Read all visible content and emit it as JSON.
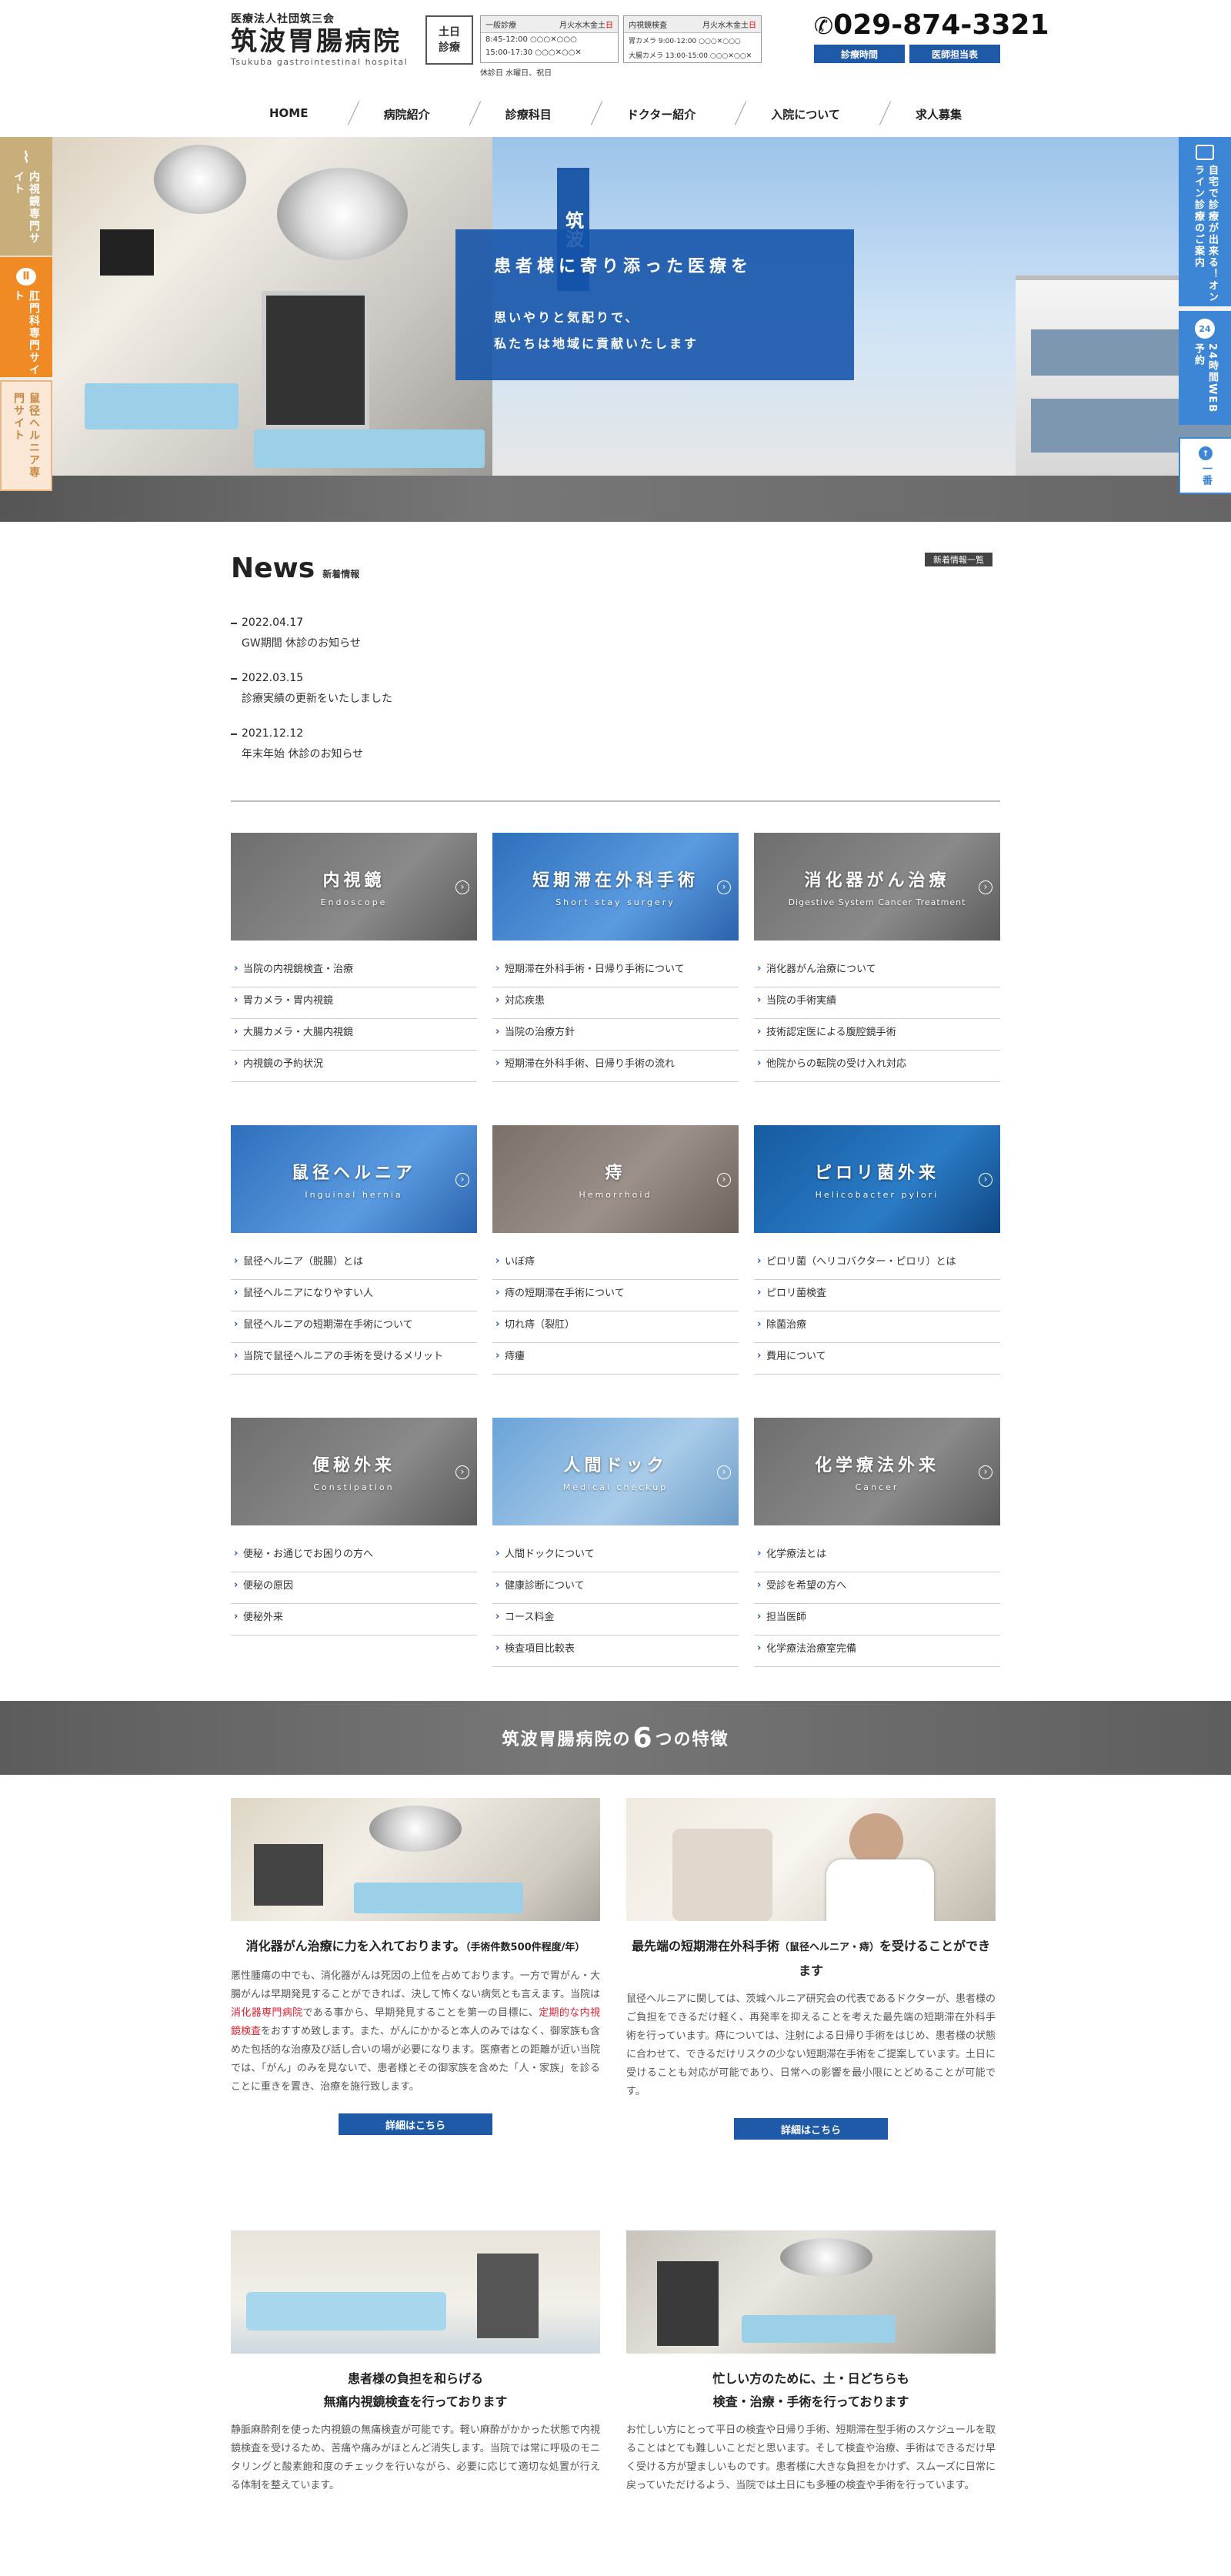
{
  "header": {
    "corp": "医療法人社団筑三会",
    "name": "筑波胃腸病院",
    "en": "Tsukuba gastrointestinal hospital",
    "weekend": "土日診療",
    "sched1": {
      "title": "一般診療",
      "days": "月火水木金土",
      "red": "日",
      "row1": "8:45-12:00 ○○○✕○○○",
      "row2": "15:00-17:30 ○○○✕○○✕"
    },
    "sched2": {
      "title": "内視鏡検査",
      "days": "月火水木金土",
      "red": "日",
      "row1": "胃カメラ 9:00-12:00 ○○○✕○○○",
      "row2": "大腸カメラ 13:00-15:00 ○○○✕○○✕"
    },
    "holiday": "休診日 水曜日、祝日",
    "tel": "029-874-3321",
    "btn_hours": "診療時間",
    "btn_doctor": "医師担当表"
  },
  "nav": [
    "HOME",
    "病院紹介",
    "診療科目",
    "ドクター紹介",
    "入院について",
    "求人募集"
  ],
  "hero": {
    "title": "患者様に寄り添った医療を",
    "line1": "思いやりと気配りで、",
    "line2": "私たちは地域に貢献いたします",
    "sign": "筑波"
  },
  "left_tabs": [
    "内視鏡専門サイト",
    "肛門科専門サイト",
    "鼠径ヘルニア専門サイト"
  ],
  "right_tabs": [
    "自宅で診療が出来る！オンライン診療のご案内",
    "24時間WEB予約",
    "一番"
  ],
  "news": {
    "title": "News",
    "sub": "新着情報",
    "list_button": "新着情報一覧",
    "items": [
      {
        "date": "2022.04.17",
        "text": "GW期間 休診のお知らせ"
      },
      {
        "date": "2022.03.15",
        "text": "診療実績の更新をいたしました"
      },
      {
        "date": "2021.12.12",
        "text": "年末年始 休診のお知らせ"
      }
    ]
  },
  "categories": [
    {
      "jp": "内視鏡",
      "en": "Endoscope",
      "items": [
        "当院の内視鏡検査・治療",
        "胃カメラ・胃内視鏡",
        "大腸カメラ・大腸内視鏡",
        "内視鏡の予約状況"
      ]
    },
    {
      "jp": "短期滞在外科手術",
      "en": "Short stay surgery",
      "items": [
        "短期滞在外科手術・日帰り手術について",
        "対応疾患",
        "当院の治療方針",
        "短期滞在外科手術、日帰り手術の流れ"
      ]
    },
    {
      "jp": "消化器がん治療",
      "en": "Digestive System Cancer Treatment",
      "items": [
        "消化器がん治療について",
        "当院の手術実績",
        "技術認定医による腹腔鏡手術",
        "他院からの転院の受け入れ対応"
      ]
    },
    {
      "jp": "鼠径ヘルニア",
      "en": "Inguinal hernia",
      "items": [
        "鼠径ヘルニア（脱腸）とは",
        "鼠径ヘルニアになりやすい人",
        "鼠径ヘルニアの短期滞在手術について",
        "当院で鼠径ヘルニアの手術を受けるメリット"
      ]
    },
    {
      "jp": "痔",
      "en": "Hemorrhoid",
      "items": [
        "いぼ痔",
        "痔の短期滞在手術について",
        "切れ痔（裂肛）",
        "痔瘻"
      ]
    },
    {
      "jp": "ピロリ菌外来",
      "en": "Helicobacter pylori",
      "items": [
        "ピロリ菌（ヘリコバクター・ピロリ）とは",
        "ピロリ菌検査",
        "除菌治療",
        "費用について"
      ]
    },
    {
      "jp": "便秘外来",
      "en": "Constipation",
      "items": [
        "便秘・お通じでお困りの方へ",
        "便秘の原因",
        "便秘外来"
      ]
    },
    {
      "jp": "人間ドック",
      "en": "Medical checkup",
      "items": [
        "人間ドックについて",
        "健康診断について",
        "コース料金",
        "検査項目比較表"
      ]
    },
    {
      "jp": "化学療法外来",
      "en": "Cancer",
      "items": [
        "化学療法とは",
        "受診を希望の方へ",
        "担当医師",
        "化学療法治療室完備"
      ]
    }
  ],
  "features": {
    "band_pre": "筑波胃腸病院の",
    "band_num": "6",
    "band_post": "つの特徴",
    "more": "詳細はこちら",
    "f1": {
      "title": "消化器がん治療に力を入れております。",
      "small": "（手術件数500件程度/年）",
      "p1": "悪性腫瘍の中でも、消化器がんは死因の上位を占めております。一方で胃がん・大腸がんは早期発見することができれば、決して怖くない病気とも言えます。当院は",
      "hl1": "消化器専門病院",
      "p2": "である事から、早期発見することを第一の目標に、",
      "hl2": "定期的な内視鏡検査",
      "p3": "をおすすめ致します。また、がんにかかると本人のみではなく、御家族も含めた包括的な治療及び話し合いの場が必要になります。医療者との距離が近い当院では、「がん」のみを見ないで、患者様とその御家族を含めた「人・家族」を診ることに重きを置き、治療を施行致します。"
    },
    "f2": {
      "title": "最先端の短期滞在外科手術",
      "small": "（鼠径ヘルニア・痔）",
      "title2": "を受けることができます",
      "p": "鼠径ヘルニアに関しては、茨城ヘルニア研究会の代表であるドクターが、患者様のご負担をできるだけ軽く、再発率を抑えることを考えた最先端の短期滞在外科手術を行っています。痔については、注射による日帰り手術をはじめ、患者様の状態に合わせて、できるだけリスクの少ない短期滞在手術をご提案しています。土日に受けることも対応が可能であり、日常への影響を最小限にとどめることが可能です。"
    },
    "f3": {
      "title1": "患者様の負担を和らげる",
      "title2": "無痛内視鏡検査を行っております",
      "p": "静脈麻酔剤を使った内視鏡の無痛検査が可能です。軽い麻酔がかかった状態で内視鏡検査を受けるため、苦痛や痛みがほとんど消失します。当院では常に呼吸のモニタリングと酸素飽和度のチェックを行いながら、必要に応じて適切な処置が行える体制を整えています。"
    },
    "f4": {
      "title1": "忙しい方のために、土・日どちらも",
      "title2": "検査・治療・手術を行っております",
      "p": "お忙しい方にとって平日の検査や日帰り手術、短期滞在型手術のスケジュールを取ることはとても難しいことだと思います。そして検査や治療、手術はできるだけ早く受ける方が望ましいものです。患者様に大きな負担をかけず、スムーズに日常に戻っていただけるよう、当院では土日にも多種の検査や手術を行っています。"
    }
  },
  "colors": {
    "brand_blue": "#1e5aa8",
    "accent_orange": "#f08a24",
    "accent_tan": "#c8ae7a"
  }
}
